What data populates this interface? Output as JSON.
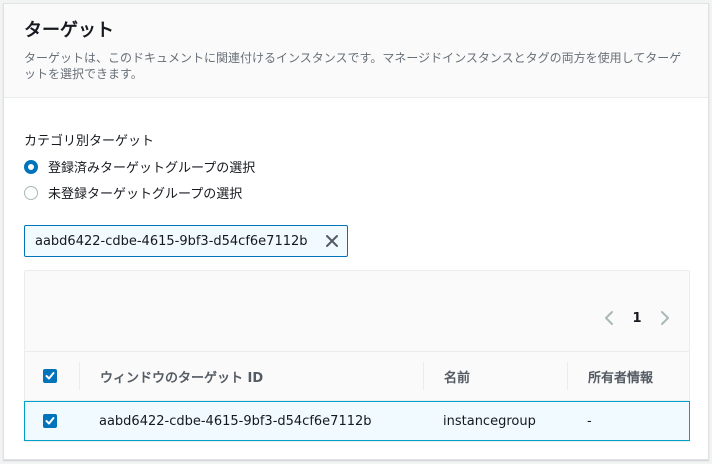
{
  "panel": {
    "title": "ターゲット",
    "description": "ターゲットは、このドキュメントに関連付けるインスタンスです。マネージドインスタンスとタグの両方を使用してターゲットを選択できます。"
  },
  "category": {
    "label": "カテゴリ別ターゲット",
    "options": [
      {
        "label": "登録済みターゲットグループの選択",
        "selected": true
      },
      {
        "label": "未登録ターゲットグループの選択",
        "selected": false
      }
    ]
  },
  "filter": {
    "token": "aabd6422-cdbe-4615-9bf3-d54cf6e7112b",
    "close_icon": "close-icon"
  },
  "pagination": {
    "current_page": "1",
    "prev_icon": "chevron-left-icon",
    "next_icon": "chevron-right-icon"
  },
  "table": {
    "columns": [
      "ウィンドウのターゲット ID",
      "名前",
      "所有者情報"
    ],
    "rows": [
      {
        "id": "aabd6422-cdbe-4615-9bf3-d54cf6e7112b",
        "name": "instancegroup",
        "owner": "-",
        "checked": true
      }
    ],
    "header_checked": true
  },
  "colors": {
    "accent": "#0073bb",
    "selected_row_bg": "#f1faff",
    "selected_row_border": "#00a1c9"
  }
}
